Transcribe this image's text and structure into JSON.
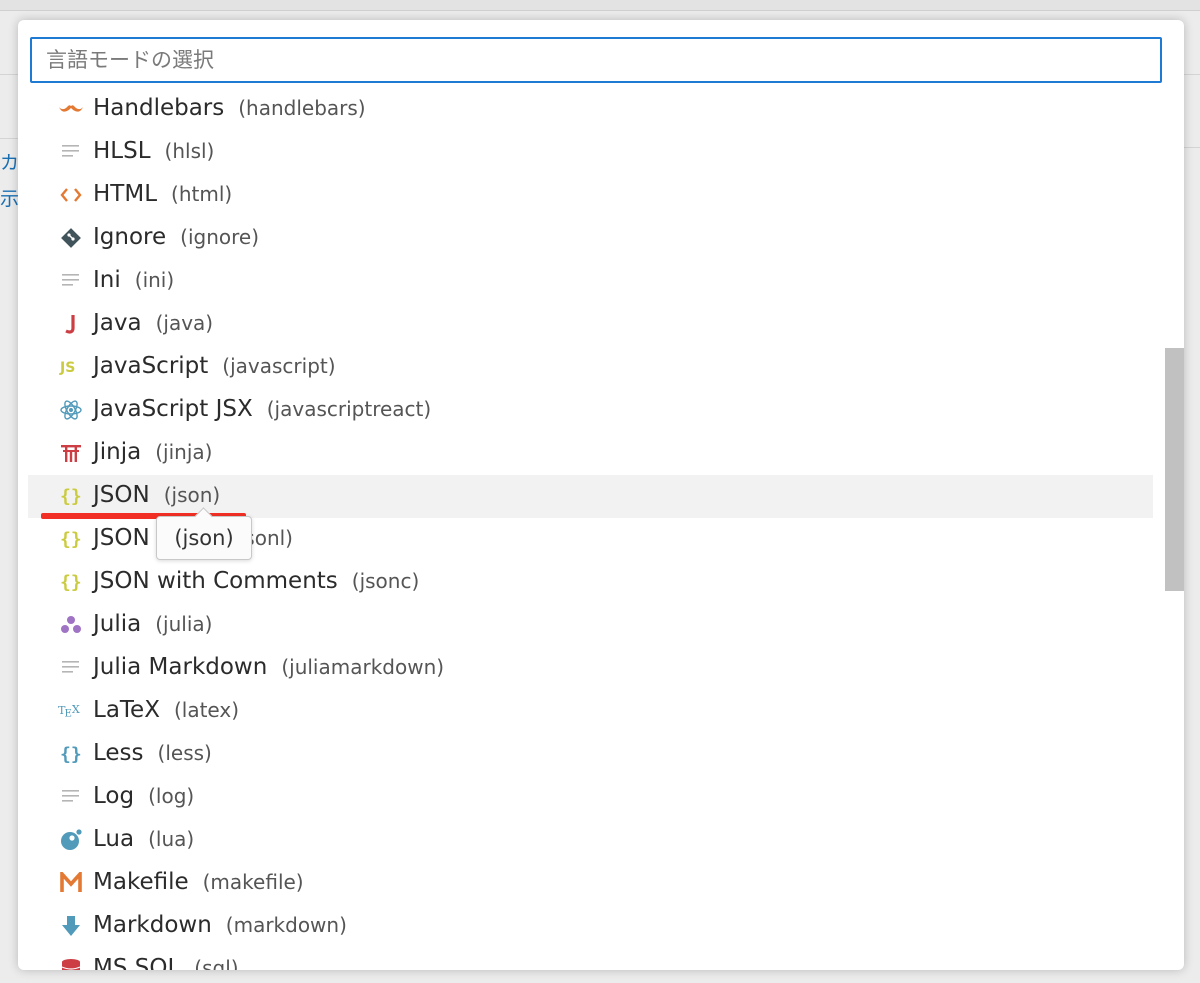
{
  "background": {
    "glyphs": [
      "カ",
      "示"
    ]
  },
  "search": {
    "placeholder": "言語モードの選択",
    "value": ""
  },
  "languages": [
    {
      "label": "Handlebars",
      "id": "(handlebars)",
      "icon": "mustache-icon"
    },
    {
      "label": "HLSL",
      "id": "(hlsl)",
      "icon": "lines-icon"
    },
    {
      "label": "HTML",
      "id": "(html)",
      "icon": "angle-brackets-icon"
    },
    {
      "label": "Ignore",
      "id": "(ignore)",
      "icon": "git-diamond-icon"
    },
    {
      "label": "Ini",
      "id": "(ini)",
      "icon": "lines-icon"
    },
    {
      "label": "Java",
      "id": "(java)",
      "icon": "java-j-icon"
    },
    {
      "label": "JavaScript",
      "id": "(javascript)",
      "icon": "js-icon"
    },
    {
      "label": "JavaScript JSX",
      "id": "(javascriptreact)",
      "icon": "react-atom-icon"
    },
    {
      "label": "Jinja",
      "id": "(jinja)",
      "icon": "torii-icon"
    },
    {
      "label": "JSON",
      "id": "(json)",
      "icon": "braces-icon",
      "selected": true
    },
    {
      "label": "JSON Lines",
      "id": "(jsonl)",
      "icon": "braces-icon"
    },
    {
      "label": "JSON with Comments",
      "id": "(jsonc)",
      "icon": "braces-icon"
    },
    {
      "label": "Julia",
      "id": "(julia)",
      "icon": "julia-dots-icon"
    },
    {
      "label": "Julia Markdown",
      "id": "(juliamarkdown)",
      "icon": "lines-icon"
    },
    {
      "label": "LaTeX",
      "id": "(latex)",
      "icon": "tex-icon"
    },
    {
      "label": "Less",
      "id": "(less)",
      "icon": "braces-blue-icon"
    },
    {
      "label": "Log",
      "id": "(log)",
      "icon": "lines-icon"
    },
    {
      "label": "Lua",
      "id": "(lua)",
      "icon": "lua-moon-icon"
    },
    {
      "label": "Makefile",
      "id": "(makefile)",
      "icon": "makefile-m-icon"
    },
    {
      "label": "Markdown",
      "id": "(markdown)",
      "icon": "markdown-arrow-icon"
    },
    {
      "label": "MS SQL",
      "id": "(sql)",
      "icon": "database-icon"
    }
  ],
  "tooltip": {
    "text": "(json)"
  },
  "colors": {
    "focus_border": "#1e7ad3",
    "underline": "#f22f25",
    "selected_row": "#f2f2f2",
    "scrollbar": "#c1c1c1"
  }
}
